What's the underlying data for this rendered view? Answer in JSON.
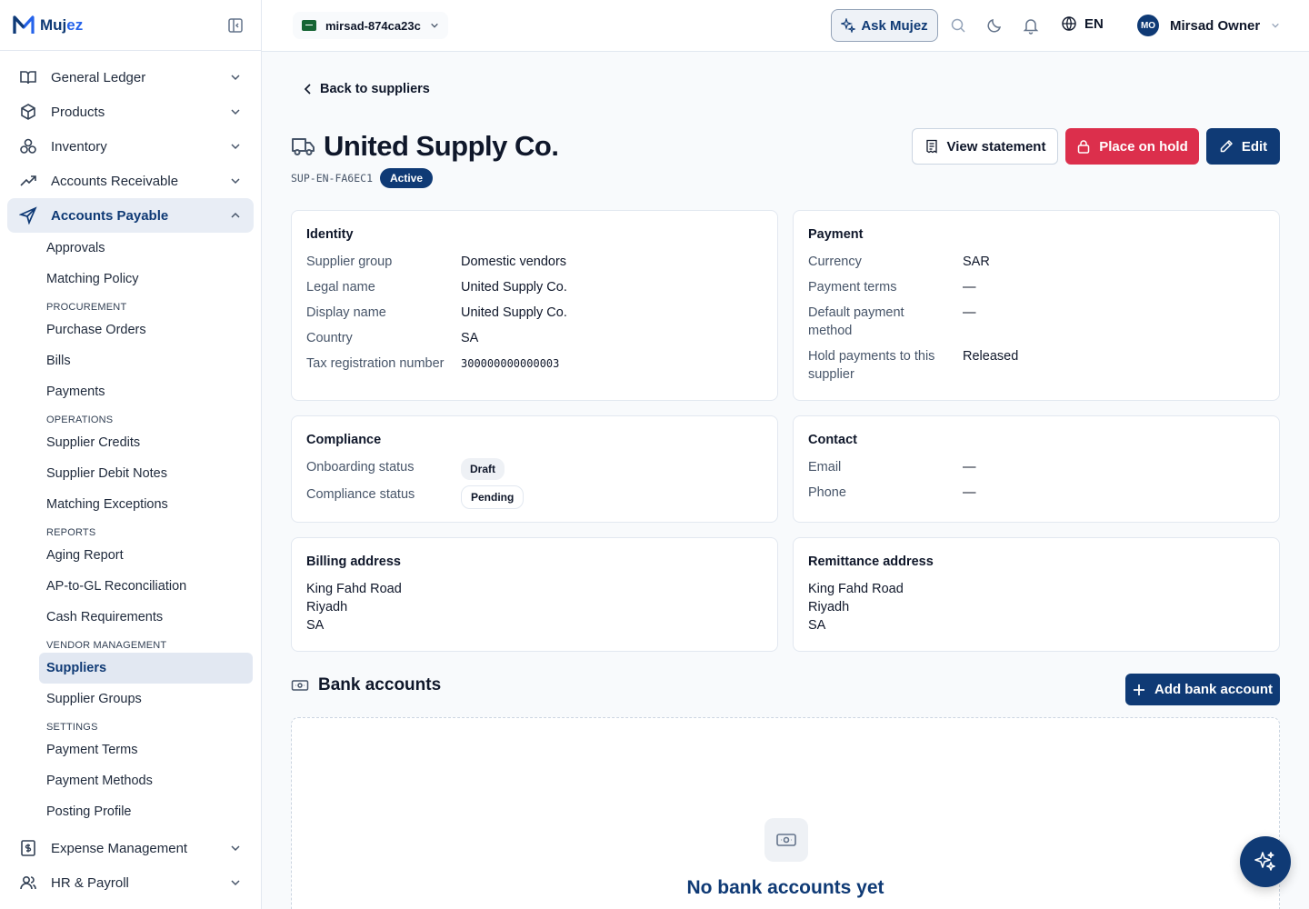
{
  "brand": {
    "name_a": "Muj",
    "name_b": "ez"
  },
  "sidebar": {
    "items": [
      {
        "label": "General Ledger"
      },
      {
        "label": "Products"
      },
      {
        "label": "Inventory"
      },
      {
        "label": "Accounts Receivable"
      },
      {
        "label": "Accounts Payable"
      }
    ],
    "ap": {
      "approvals": "Approvals",
      "matching_policy": "Matching Policy",
      "sec_procurement": "PROCUREMENT",
      "purchase_orders": "Purchase Orders",
      "bills": "Bills",
      "payments": "Payments",
      "sec_operations": "OPERATIONS",
      "supplier_credits": "Supplier Credits",
      "supplier_debit_notes": "Supplier Debit Notes",
      "matching_exceptions": "Matching Exceptions",
      "sec_reports": "REPORTS",
      "aging_report": "Aging Report",
      "ap_gl": "AP-to-GL Reconciliation",
      "cash_req": "Cash Requirements",
      "sec_vendor": "VENDOR MANAGEMENT",
      "suppliers": "Suppliers",
      "supplier_groups": "Supplier Groups",
      "sec_settings": "SETTINGS",
      "payment_terms": "Payment Terms",
      "payment_methods": "Payment Methods",
      "posting_profile": "Posting Profile"
    },
    "bottom": [
      {
        "label": "Expense Management"
      },
      {
        "label": "HR & Payroll"
      }
    ]
  },
  "topbar": {
    "tenant": "mirsad-874ca23c",
    "ask": "Ask Mujez",
    "lang": "EN",
    "user_initials": "MO",
    "user_name": "Mirsad Owner"
  },
  "page": {
    "back": "Back to suppliers",
    "title": "United Supply Co.",
    "code": "SUP-EN-FA6EC1",
    "status": "Active",
    "btn_statement": "View statement",
    "btn_hold": "Place on hold",
    "btn_edit": "Edit"
  },
  "identity": {
    "title": "Identity",
    "rows": [
      {
        "k": "Supplier group",
        "v": "Domestic vendors"
      },
      {
        "k": "Legal name",
        "v": "United Supply Co."
      },
      {
        "k": "Display name",
        "v": "United Supply Co."
      },
      {
        "k": "Country",
        "v": "SA"
      },
      {
        "k": "Tax registration number",
        "v": "300000000000003"
      }
    ]
  },
  "payment": {
    "title": "Payment",
    "rows": [
      {
        "k": "Currency",
        "v": "SAR"
      },
      {
        "k": "Payment terms",
        "v": "—"
      },
      {
        "k": "Default payment method",
        "v": "—"
      },
      {
        "k": "Hold payments to this supplier",
        "v": "Released"
      }
    ]
  },
  "compliance": {
    "title": "Compliance",
    "onboarding_k": "Onboarding status",
    "onboarding_v": "Draft",
    "compliance_k": "Compliance status",
    "compliance_v": "Pending"
  },
  "contact": {
    "title": "Contact",
    "rows": [
      {
        "k": "Email",
        "v": "—"
      },
      {
        "k": "Phone",
        "v": "—"
      }
    ]
  },
  "billing": {
    "title": "Billing address",
    "lines": [
      "King Fahd Road",
      "Riyadh",
      "SA"
    ]
  },
  "remittance": {
    "title": "Remittance address",
    "lines": [
      "King Fahd Road",
      "Riyadh",
      "SA"
    ]
  },
  "bank": {
    "title": "Bank accounts",
    "add": "Add bank account",
    "empty": "No bank accounts yet"
  },
  "colors": {
    "primary": "#0f3a75",
    "danger": "#dc2f4c",
    "accent": "#2563eb"
  }
}
